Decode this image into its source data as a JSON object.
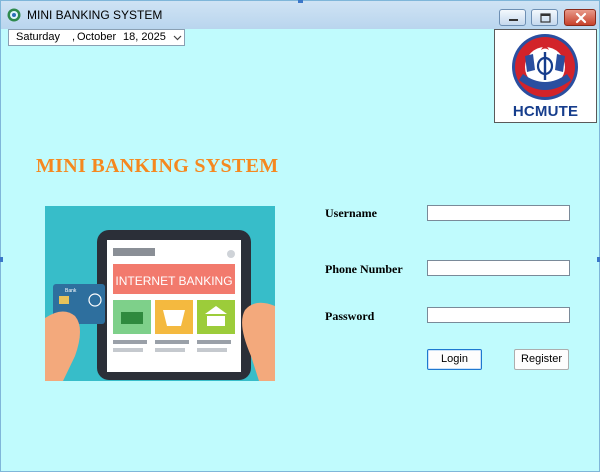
{
  "window": {
    "title": "MINI BANKING SYSTEM"
  },
  "date_picker": {
    "weekday": "Saturday",
    "separator": ",",
    "month": "October",
    "day_year": "18, 2025"
  },
  "logo": {
    "text": "HCMUTE"
  },
  "main": {
    "heading": "MINI BANKING SYSTEM"
  },
  "illustration": {
    "screen_text": "INTERNET BANKING",
    "card_text": "Bank"
  },
  "form": {
    "username_label": "Username",
    "username_value": "",
    "phone_label": "Phone Number",
    "phone_value": "",
    "password_label": "Password",
    "password_value": "",
    "login_label": "Login",
    "register_label": "Register"
  },
  "colors": {
    "background": "#c0fbfd",
    "heading": "#f5881f",
    "logo_blue": "#163d8c",
    "logo_red": "#d2232a"
  }
}
